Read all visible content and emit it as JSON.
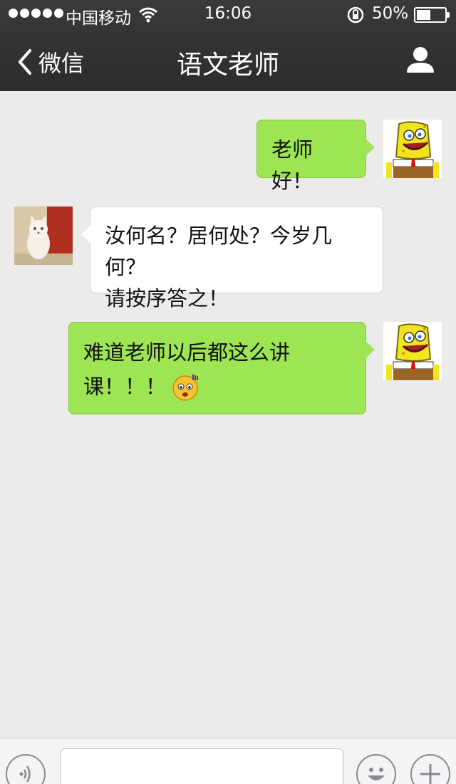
{
  "status": {
    "carrier": "中国移动",
    "time": "16:06",
    "battery": "50%"
  },
  "nav": {
    "back_label": "微信",
    "title": "语文老师"
  },
  "messages": [
    {
      "from": "me",
      "text": "老师好！"
    },
    {
      "from": "them",
      "lines": [
        "汝何名？居何处？今岁几何？",
        "请按序答之！"
      ]
    },
    {
      "from": "me",
      "lines": [
        "难道老师以后都这么讲",
        "课！！！"
      ]
    }
  ],
  "colors": {
    "bubble_me": "#9ee554",
    "bubble_them": "#ffffff",
    "background": "#ebebeb",
    "navbar": "#2c2c2e"
  },
  "icons": [
    "back-chevron-icon",
    "user-profile-icon",
    "voice-icon",
    "emoji-icon",
    "plus-icon"
  ]
}
